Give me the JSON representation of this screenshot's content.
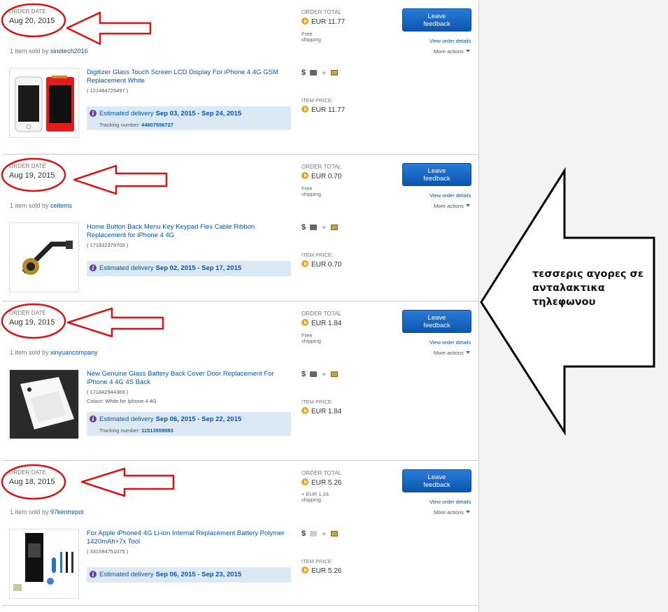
{
  "labels": {
    "order_date": "ORDER DATE",
    "order_total": "ORDER TOTAL",
    "item_price": "ITEM PRICE:",
    "leave_feedback": "Leave feedback",
    "view_order_details": "View order details",
    "more_actions": "More actions",
    "item_sold_by": "1 item sold by",
    "estimated_delivery": "Estimated delivery",
    "tracking_number": "Tracking number:"
  },
  "orders": [
    {
      "date": "Aug 20, 2015",
      "total": "EUR 11.77",
      "shipping": "Free shipping",
      "seller": "sinotech2016",
      "title": "Digitizer Glass Touch Screen LCD Display For iPhone 4 4G GSM Replacement White",
      "item_number": "( 121484725497 )",
      "variation": "",
      "delivery": "Sep 03, 2015 - Sep 24, 2015",
      "tracking": "44807556727",
      "item_price": "EUR 11.77",
      "thumb": "screen-white-red"
    },
    {
      "date": "Aug 19, 2015",
      "total": "EUR 0.70",
      "shipping": "Free shipping",
      "seller": "ceitems",
      "title": "Home Button Back Menu Key Keypad Flex Cable Ribbon Replacement for iPhone 4 4G",
      "item_number": "( 171832379709 )",
      "variation": "",
      "delivery": "Sep 02, 2015 - Sep 17, 2015",
      "tracking": "",
      "item_price": "EUR 0.70",
      "thumb": "flex-cable"
    },
    {
      "date": "Aug 19, 2015",
      "total": "EUR 1.84",
      "shipping": "Free shipping",
      "seller": "xinyuancompany",
      "title": "New Genuine Glass Battery Back Cover Door Replacement For iPhone 4 4G 4S Back",
      "item_number": "( 171842944369 )",
      "variation": "Colour: White for Iphone 4 4G",
      "delivery": "Sep 06, 2015 - Sep 22, 2015",
      "tracking": "11513559083",
      "item_price": "EUR 1.84",
      "thumb": "back-cover"
    },
    {
      "date": "Aug 18, 2015",
      "total": "EUR 5.26",
      "shipping": "+ EUR 1.33 shipping",
      "seller": "97kentrepot",
      "title": "For Apple iPhone4 4G Li-ion Internal Replacement Battery Polymer 1420mAh+7x Tool",
      "item_number": "( 331594751075 )",
      "variation": "",
      "delivery": "Sep 06, 2015 - Sep 23, 2015",
      "tracking": "",
      "item_price": "EUR 5.26",
      "thumb": "battery-tools"
    }
  ],
  "annotation": {
    "lines": [
      "τεσσερις αγορες σε",
      "ανταλακτικα",
      "τηλεφωνου"
    ],
    "color": "#cc1111"
  }
}
